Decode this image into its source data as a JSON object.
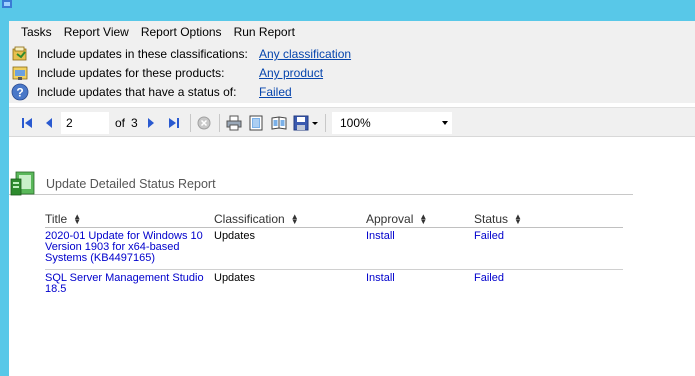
{
  "menu": [
    "Tasks",
    "Report View",
    "Report Options",
    "Run Report"
  ],
  "filters": [
    {
      "label": "Include updates in these classifications:",
      "value": "Any classification",
      "icon": "classification-icon"
    },
    {
      "label": "Include updates for these products:",
      "value": "Any product",
      "icon": "product-icon"
    },
    {
      "label": "Include updates that have a status of:",
      "value": "Failed",
      "icon": "help-icon"
    }
  ],
  "toolbar": {
    "current_page": "2",
    "of_label": "of",
    "total_pages": "3",
    "zoom": "100%"
  },
  "report": {
    "title": "Update Detailed Status Report",
    "columns": [
      "Title",
      "Classification",
      "Approval",
      "Status"
    ],
    "rows": [
      {
        "title": [
          "2020-01 Update for Windows 10",
          "Version 1903 for x64-based",
          "Systems (KB4497165)"
        ],
        "classification": "Updates",
        "approval": "Install",
        "status": "Failed"
      },
      {
        "title": [
          "SQL Server Management Studio",
          "18.5"
        ],
        "classification": "Updates",
        "approval": "Install",
        "status": "Failed"
      }
    ]
  },
  "colors": {
    "link": "#0645ad",
    "cell_link": "#0000cc",
    "chrome": "#f0f0f0",
    "titlebar": "#58c8e8"
  }
}
